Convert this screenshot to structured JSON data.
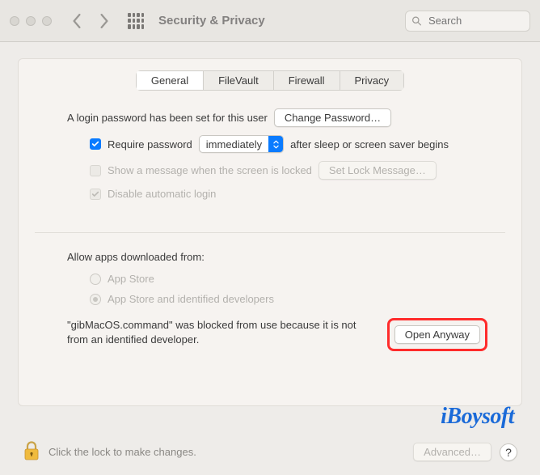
{
  "toolbar": {
    "title": "Security & Privacy",
    "search_placeholder": "Search"
  },
  "tabs": [
    {
      "label": "General",
      "active": true
    },
    {
      "label": "FileVault",
      "active": false
    },
    {
      "label": "Firewall",
      "active": false
    },
    {
      "label": "Privacy",
      "active": false
    }
  ],
  "login": {
    "password_set_text": "A login password has been set for this user",
    "change_password_label": "Change Password…",
    "require_password_label": "Require password",
    "require_password_delay": "immediately",
    "require_password_suffix": "after sleep or screen saver begins",
    "show_message_label": "Show a message when the screen is locked",
    "set_lock_message_label": "Set Lock Message…",
    "disable_auto_login_label": "Disable automatic login"
  },
  "allow_apps": {
    "heading": "Allow apps downloaded from:",
    "options": [
      {
        "label": "App Store",
        "selected": false
      },
      {
        "label": "App Store and identified developers",
        "selected": true
      }
    ],
    "blocked_text": "\"gibMacOS.command\" was blocked from use because it is not from an identified developer.",
    "open_anyway_label": "Open Anyway"
  },
  "footer": {
    "lock_text": "Click the lock to make changes.",
    "advanced_label": "Advanced…",
    "help_label": "?"
  },
  "watermark": "iBoysoft"
}
